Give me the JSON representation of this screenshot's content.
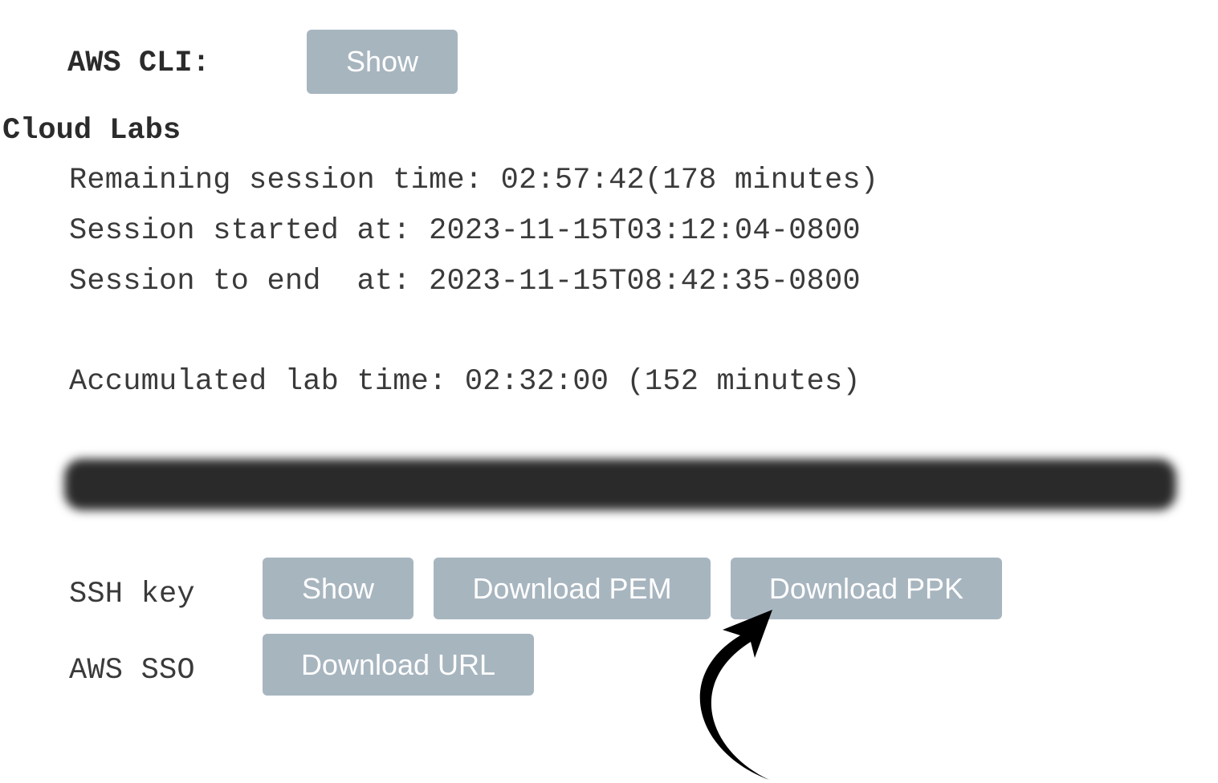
{
  "aws_cli": {
    "label": "AWS CLI:",
    "show_button": "Show"
  },
  "section": {
    "title": "Cloud Labs"
  },
  "session": {
    "remaining": "Remaining session time: 02:57:42(178 minutes)",
    "started": "Session started at: 2023-11-15T03:12:04-0800",
    "ends": "Session to end  at: 2023-11-15T08:42:35-0800",
    "accumulated": "Accumulated lab time: 02:32:00 (152 minutes)"
  },
  "ssh_key": {
    "label": "SSH key",
    "show_button": "Show",
    "download_pem_button": "Download PEM",
    "download_ppk_button": "Download PPK"
  },
  "aws_sso": {
    "label": "AWS SSO",
    "download_url_button": "Download URL"
  },
  "colors": {
    "button_bg": "#a7b5bf",
    "button_text": "#ffffff"
  },
  "icons": {
    "annotation": "curved-arrow-icon"
  }
}
